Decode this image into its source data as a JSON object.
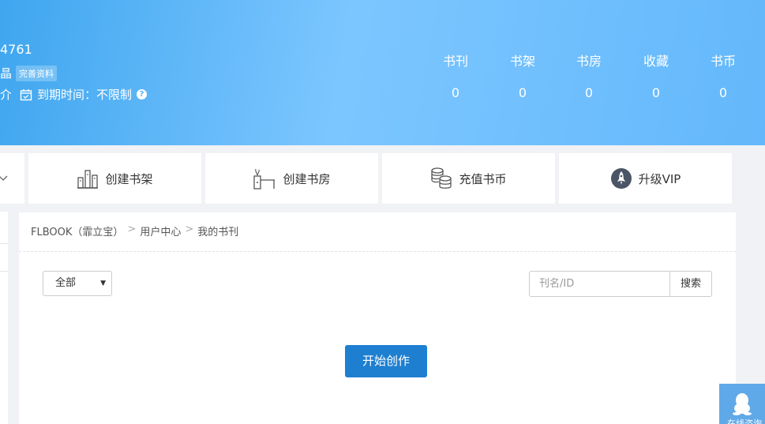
{
  "header": {
    "user_id": "4761",
    "user_level": "晶",
    "complete_profile": "完善资料",
    "expire_prefix": "介",
    "expire_label": "到期时间：不限制",
    "help": "?"
  },
  "stats": [
    {
      "label": "书刊",
      "value": "0"
    },
    {
      "label": "书架",
      "value": "0"
    },
    {
      "label": "书房",
      "value": "0"
    },
    {
      "label": "收藏",
      "value": "0"
    },
    {
      "label": "书币",
      "value": "0"
    }
  ],
  "actions": [
    {
      "label": "创建书架",
      "icon": "bookshelf-icon"
    },
    {
      "label": "创建书房",
      "icon": "study-room-icon"
    },
    {
      "label": "充值书币",
      "icon": "coins-icon"
    },
    {
      "label": "升级VIP",
      "icon": "rocket-icon"
    }
  ],
  "breadcrumb": [
    "FLBOOK（霏立宝）",
    "用户中心",
    "我的书刊"
  ],
  "breadcrumb_sep": ">",
  "filter": {
    "selected": "全部"
  },
  "search": {
    "placeholder": "刊名/ID",
    "button": "搜索"
  },
  "create_button": "开始创作",
  "float": {
    "text": "在线咨询"
  },
  "colors": {
    "header": "#63b8fb",
    "primary_button": "#1e7fd1"
  }
}
